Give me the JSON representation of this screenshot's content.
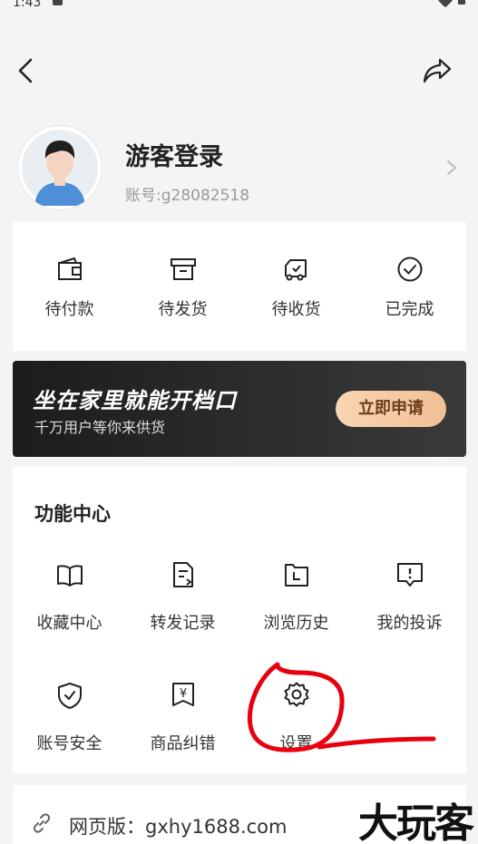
{
  "status_bar": {
    "time": "1:43"
  },
  "profile": {
    "name": "游客登录",
    "account": "账号:g28082518"
  },
  "orders": [
    {
      "label": "待付款",
      "icon": "wallet-icon"
    },
    {
      "label": "待发货",
      "icon": "archive-box-icon"
    },
    {
      "label": "待收货",
      "icon": "truck-icon"
    },
    {
      "label": "已完成",
      "icon": "check-circle-icon"
    }
  ],
  "banner": {
    "title": "坐在家里就能开档口",
    "subtitle": "千万用户等你来供货",
    "button": "立即申请"
  },
  "functions": {
    "title": "功能中心",
    "items": [
      {
        "label": "收藏中心",
        "icon": "book-icon"
      },
      {
        "label": "转发记录",
        "icon": "forward-record-icon"
      },
      {
        "label": "浏览历史",
        "icon": "history-icon"
      },
      {
        "label": "我的投诉",
        "icon": "complaint-icon"
      },
      {
        "label": "账号安全",
        "icon": "shield-icon"
      },
      {
        "label": "商品纠错",
        "icon": "yuan-icon"
      },
      {
        "label": "设置",
        "icon": "gear-icon"
      }
    ]
  },
  "website": {
    "label": "网页版：gxhy1688.com"
  },
  "watermark": "大玩客",
  "colors": {
    "banner_button": "#f2c096",
    "annotation": "#e8000f"
  }
}
